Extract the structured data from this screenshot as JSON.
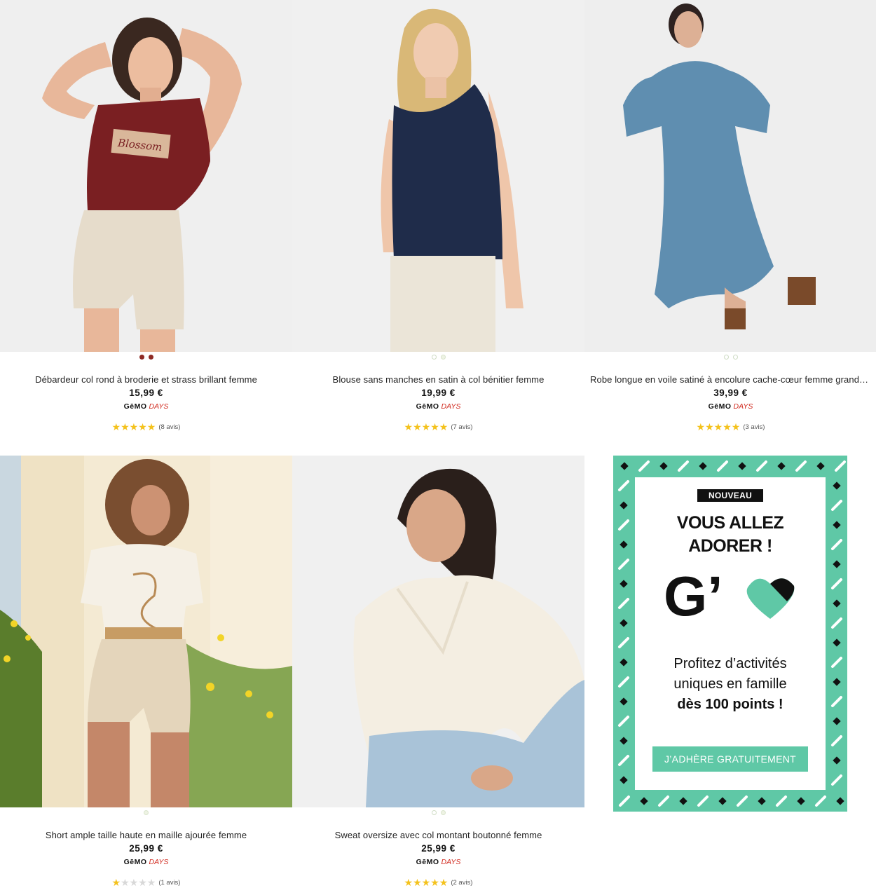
{
  "products": [
    {
      "name": "Débardeur col rond à broderie et strass brillant femme",
      "price": "15,99 €",
      "brand": "GēMO",
      "brand_tag": "DAYS",
      "rating": 5,
      "reviews": "(8 avis)",
      "print_text": "Blossom"
    },
    {
      "name": "Blouse sans manches en satin à col bénitier femme",
      "price": "19,99 €",
      "brand": "GēMO",
      "brand_tag": "DAYS",
      "rating": 5,
      "reviews": "(7 avis)"
    },
    {
      "name": "Robe longue en voile satiné à encolure cache-cœur femme grande taille",
      "price": "39,99 €",
      "brand": "GēMO",
      "brand_tag": "DAYS",
      "rating": 5,
      "reviews": "(3 avis)"
    },
    {
      "name": "Short ample taille haute en maille ajourée femme",
      "price": "25,99 €",
      "brand": "GēMO",
      "brand_tag": "DAYS",
      "rating": 1,
      "reviews": "(1 avis)"
    },
    {
      "name": "Sweat oversize avec col montant boutonné femme",
      "price": "25,99 €",
      "brand": "GēMO",
      "brand_tag": "DAYS",
      "rating": 5,
      "reviews": "(2 avis)"
    }
  ],
  "promo": {
    "badge": "NOUVEAU",
    "title_line1": "VOUS ALLEZ",
    "title_line2": "ADORER !",
    "logo_text": "G’",
    "text_line1": "Profitez d’activités",
    "text_line2": "uniques en famille",
    "text_line3": "dès 100 points !",
    "button": "J’ADHÈRE GRATUITEMENT"
  },
  "colors": {
    "star": "#f4c21c",
    "brand_accent": "#d12a1f",
    "promo_green": "#5fc8a6"
  }
}
